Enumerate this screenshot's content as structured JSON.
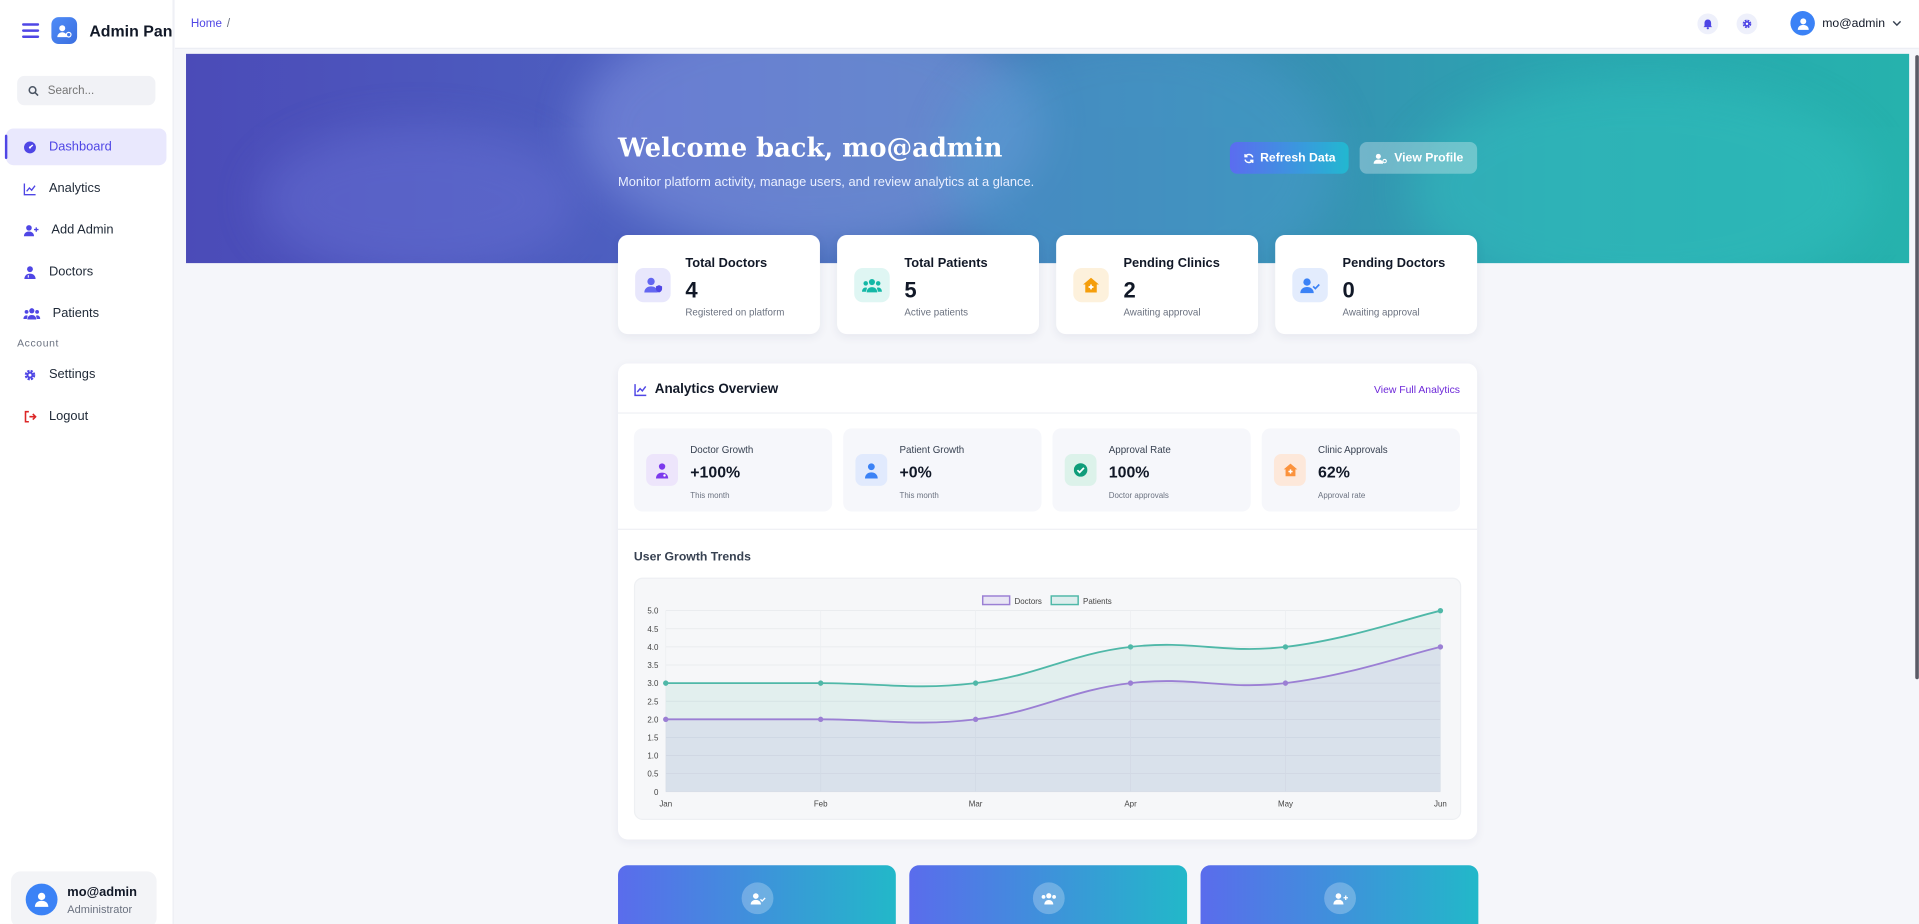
{
  "sidebar": {
    "brand": "Admin Panel",
    "search_placeholder": "Search...",
    "items": [
      {
        "label": "Dashboard",
        "icon": "dashboard-icon",
        "active": true
      },
      {
        "label": "Analytics",
        "icon": "chart-line-icon"
      },
      {
        "label": "Add Admin",
        "icon": "user-plus-icon"
      },
      {
        "label": "Doctors",
        "icon": "doctor-icon"
      },
      {
        "label": "Patients",
        "icon": "users-icon"
      }
    ],
    "account_section": "Account",
    "account_items": [
      {
        "label": "Settings",
        "icon": "gear-icon"
      },
      {
        "label": "Logout",
        "icon": "logout-icon"
      }
    ],
    "user": {
      "name": "mo@admin",
      "role": "Administrator"
    }
  },
  "topbar": {
    "breadcrumb": "Home",
    "breadcrumb_sep": "/",
    "user_name": "mo@admin"
  },
  "hero": {
    "title": "Welcome back, mo@admin",
    "subtitle": "Monitor platform activity, manage users, and review analytics at a glance.",
    "refresh_label": "Refresh Data",
    "profile_label": "View Profile"
  },
  "stats": [
    {
      "title": "Total Doctors",
      "value": "4",
      "sub": "Registered on platform",
      "color": "#6366f1"
    },
    {
      "title": "Total Patients",
      "value": "5",
      "sub": "Active patients",
      "color": "#14b8a6"
    },
    {
      "title": "Pending Clinics",
      "value": "2",
      "sub": "Awaiting approval",
      "color": "#f59e0b"
    },
    {
      "title": "Pending Doctors",
      "value": "0",
      "sub": "Awaiting approval",
      "color": "#3b82f6"
    }
  ],
  "analytics": {
    "title": "Analytics Overview",
    "link": "View Full Analytics",
    "metrics": [
      {
        "label": "Doctor Growth",
        "value": "+100%",
        "sub": "This month",
        "color": "#7c3aed"
      },
      {
        "label": "Patient Growth",
        "value": "+0%",
        "sub": "This month",
        "color": "#3b82f6"
      },
      {
        "label": "Approval Rate",
        "value": "100%",
        "sub": "Doctor approvals",
        "color": "#0f9d7a"
      },
      {
        "label": "Clinic Approvals",
        "value": "62%",
        "sub": "Approval rate",
        "color": "#fb923c"
      }
    ],
    "chart_title": "User Growth Trends"
  },
  "chart_data": {
    "type": "line",
    "x": [
      "Jan",
      "Feb",
      "Mar",
      "Apr",
      "May",
      "Jun"
    ],
    "series": [
      {
        "name": "Doctors",
        "values": [
          2,
          2,
          2,
          3,
          3,
          4
        ],
        "color": "#9b7fd4"
      },
      {
        "name": "Patients",
        "values": [
          3,
          3,
          3,
          4,
          4,
          5
        ],
        "color": "#4fb8a8"
      }
    ],
    "yticks": [
      "0",
      "0.5",
      "1.0",
      "1.5",
      "2.0",
      "2.5",
      "3.0",
      "3.5",
      "4.0",
      "4.5",
      "5.0"
    ],
    "ylim": [
      0,
      5
    ],
    "legend": "top-center",
    "fill": true
  }
}
